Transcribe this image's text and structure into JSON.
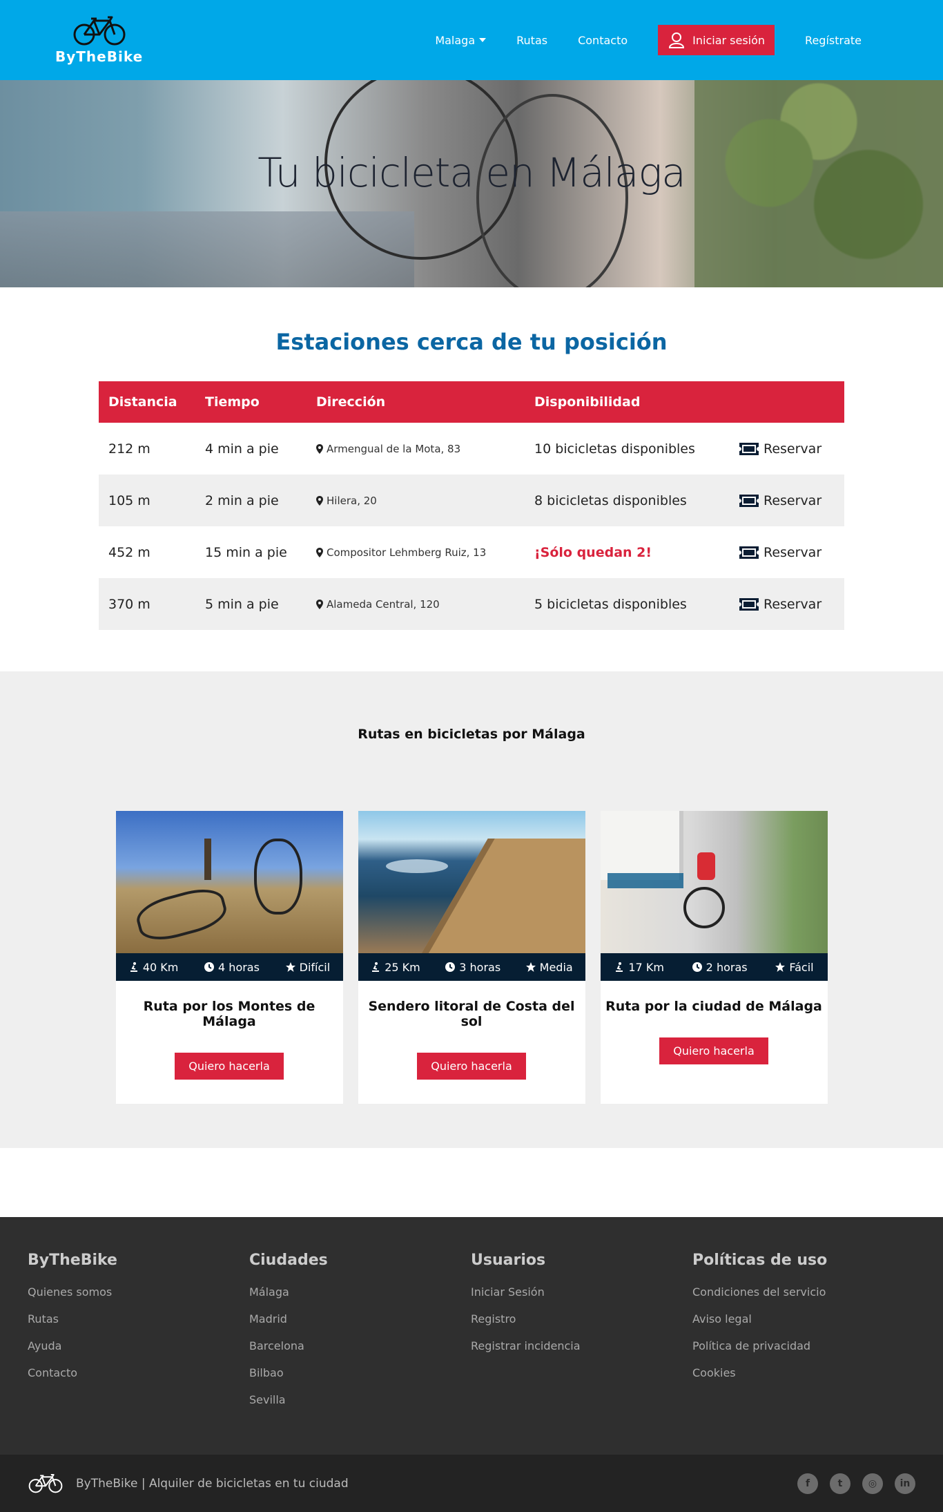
{
  "header": {
    "logo_text": "ByTheBike",
    "nav": {
      "city": "Malaga",
      "routes": "Rutas",
      "contact": "Contacto",
      "login": "Iniciar sesión",
      "register": "Regístrate"
    }
  },
  "hero": {
    "title": "Tu bicicleta en Málaga"
  },
  "stations": {
    "title": "Estaciones cerca de tu posición",
    "columns": [
      "Distancia",
      "Tiempo",
      "Dirección",
      "Disponibilidad"
    ],
    "rows": [
      {
        "distance": "212 m",
        "time": "4 min a pie",
        "address": "Armengual de la Mota, 83",
        "availability": "10 bicicletas disponibles",
        "action": "Reservar"
      },
      {
        "distance": "105 m",
        "time": "2 min a pie",
        "address": "Hilera, 20",
        "availability": "8 bicicletas disponibles",
        "action": "Reservar"
      },
      {
        "distance": "452 m",
        "time": "15 min a pie",
        "address": "Compositor Lehmberg Ruiz, 13",
        "availability": "¡Sólo quedan 2!",
        "action": "Reservar"
      },
      {
        "distance": "370 m",
        "time": "5 min a pie",
        "address": "Alameda Central, 120",
        "availability": "5 bicicletas disponibles",
        "action": "Reservar"
      }
    ]
  },
  "routes": {
    "title": "Rutas en bicicletas por Málaga",
    "cards": [
      {
        "distance": "40 Km",
        "duration": "4 horas",
        "difficulty": "Difícil",
        "title": "Ruta por los Montes de Málaga",
        "button": "Quiero hacerla"
      },
      {
        "distance": "25 Km",
        "duration": "3 horas",
        "difficulty": "Media",
        "title": "Sendero litoral de Costa del sol",
        "button": "Quiero hacerla"
      },
      {
        "distance": "17 Km",
        "duration": "2 horas",
        "difficulty": "Fácil",
        "title": "Ruta por la ciudad de Málaga",
        "button": "Quiero hacerla"
      }
    ]
  },
  "footer": {
    "columns": [
      {
        "title": "ByTheBike",
        "links": [
          "Quienes somos",
          "Rutas",
          "Ayuda",
          "Contacto"
        ]
      },
      {
        "title": "Ciudades",
        "links": [
          "Málaga",
          "Madrid",
          "Barcelona",
          "Bilbao",
          "Sevilla"
        ]
      },
      {
        "title": "Usuarios",
        "links": [
          "Iniciar Sesión",
          "Registro",
          "Registrar incidencia"
        ]
      },
      {
        "title": "Políticas de uso",
        "links": [
          "Condiciones del servicio",
          "Aviso legal",
          "Política de privacidad",
          "Cookies"
        ]
      }
    ],
    "copyright": "ByTheBike | Alquiler de bicicletas en tu ciudad",
    "social": [
      "facebook-icon",
      "twitter-icon",
      "instagram-icon",
      "linkedin-icon"
    ]
  },
  "colors": {
    "primary": "#00a8e8",
    "accent": "#d9233d",
    "title": "#0b66a3",
    "stats_bar": "#061e33"
  }
}
